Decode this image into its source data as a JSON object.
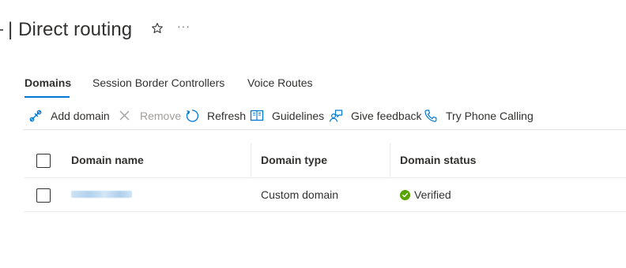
{
  "page": {
    "title": "| Direct routing",
    "more_label": "···"
  },
  "tabs": [
    {
      "label": "Domains",
      "active": true
    },
    {
      "label": "Session Border Controllers",
      "active": false
    },
    {
      "label": "Voice Routes",
      "active": false
    }
  ],
  "toolbar": {
    "add_domain": "Add domain",
    "remove": "Remove",
    "refresh": "Refresh",
    "guidelines": "Guidelines",
    "give_feedback": "Give feedback",
    "try_phone_calling": "Try Phone Calling"
  },
  "grid": {
    "columns": [
      "Domain name",
      "Domain type",
      "Domain status"
    ],
    "rows": [
      {
        "domain_name": "",
        "domain_type": "Custom domain",
        "domain_status": "Verified"
      }
    ]
  },
  "colors": {
    "accent": "#0078d4",
    "status_verified": "#57a300",
    "text": "#323130",
    "disabled": "#a19f9d"
  }
}
